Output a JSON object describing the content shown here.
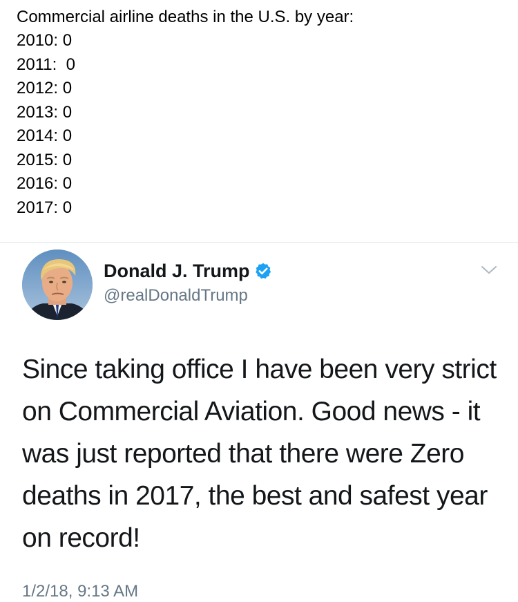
{
  "note": {
    "title": "Commercial airline deaths in the U.S. by year:",
    "lines": [
      "2010: 0",
      "2011:  0",
      "2012: 0",
      "2013: 0",
      "2014: 0",
      "2015: 0",
      "2016: 0",
      "2017: 0"
    ]
  },
  "tweet": {
    "author_name": "Donald J. Trump",
    "handle": "@realDonaldTrump",
    "verified": true,
    "text": "Since taking office I have been very strict on Commercial Aviation. Good news - it was just reported that there were Zero deaths in 2017, the best and safest year on record!",
    "timestamp": "1/2/18, 9:13 AM",
    "icons": {
      "avatar": "profile-photo",
      "verified": "verified-badge-icon",
      "menu": "chevron-down-icon"
    },
    "colors": {
      "verified": "#1da1f2",
      "secondary_text": "#657786",
      "primary_text": "#14171a"
    }
  }
}
